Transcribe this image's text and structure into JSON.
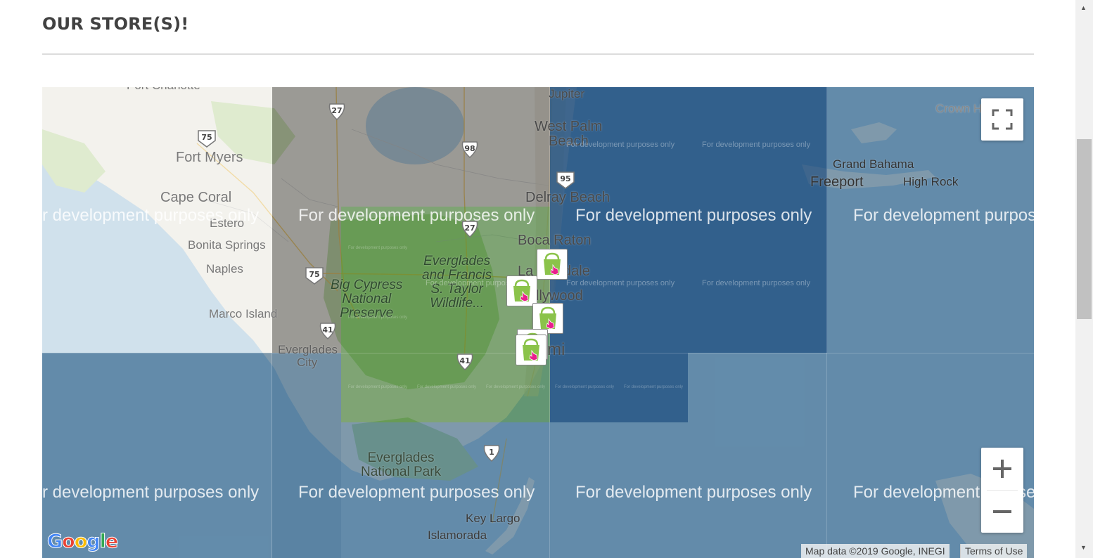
{
  "section": {
    "title": "OUR STORE(S)!"
  },
  "map": {
    "watermark": "For development purposes only",
    "watermark_cut": "r development purposes only",
    "watermark_cut_right": "For development purpose",
    "watermark_cut_right2": "For development",
    "watermark_cut_right3": "se",
    "places": {
      "jupiter": "Jupiter",
      "west_palm_beach_1": "West Palm",
      "west_palm_beach_2": "Beach",
      "fort_myers": "Fort Myers",
      "cape_coral": "Cape Coral",
      "estero": "Estero",
      "bonita_springs": "Bonita Springs",
      "naples": "Naples",
      "marco_island": "Marco Island",
      "everglades_city_1": "Everglades",
      "everglades_city_2": "City",
      "delray_beach": "Delray Beach",
      "boca_raton": "Boca Raton",
      "fort_lauderdale_part": "La",
      "fort_lauderdale_part2": "dale",
      "hollywood_part": "llywood",
      "miami_part": "mi",
      "crown_haven": "Crown H",
      "grand_bahama": "Grand Bahama",
      "freeport": "Freeport",
      "high_rock": "High Rock",
      "key_largo": "Key Largo",
      "islamorada": "Islamorada",
      "punta_gorda": "Port Charlotte",
      "big_cypress": "Big Cypress\nNational\nPreserve",
      "everglades_francis": "Everglades\nand Francis\nS. Taylor\nWildlife...",
      "everglades_np": "Everglades\nNational Park",
      "francis_small": "Francis\nS. Taylor\nWildlife..."
    },
    "shields": {
      "i75_north": "75",
      "i75_south": "75",
      "us27_north": "27",
      "us27_south": "27",
      "sr98": "98",
      "i95": "95",
      "us41_west": "41",
      "us41_east": "41",
      "us1": "1"
    },
    "store_markers_count": 5,
    "controls": {
      "fullscreen": "fullscreen-icon",
      "zoom_in": "+",
      "zoom_out": "−"
    },
    "attribution": {
      "map_data": "Map data ©2019 Google, INEGI",
      "terms": "Terms of Use"
    },
    "logo": {
      "letters": [
        "G",
        "o",
        "o",
        "g",
        "l",
        "e"
      ],
      "colors": [
        "#4285F4",
        "#EA4335",
        "#FBBC05",
        "#4285F4",
        "#34A853",
        "#EA4335"
      ]
    }
  }
}
